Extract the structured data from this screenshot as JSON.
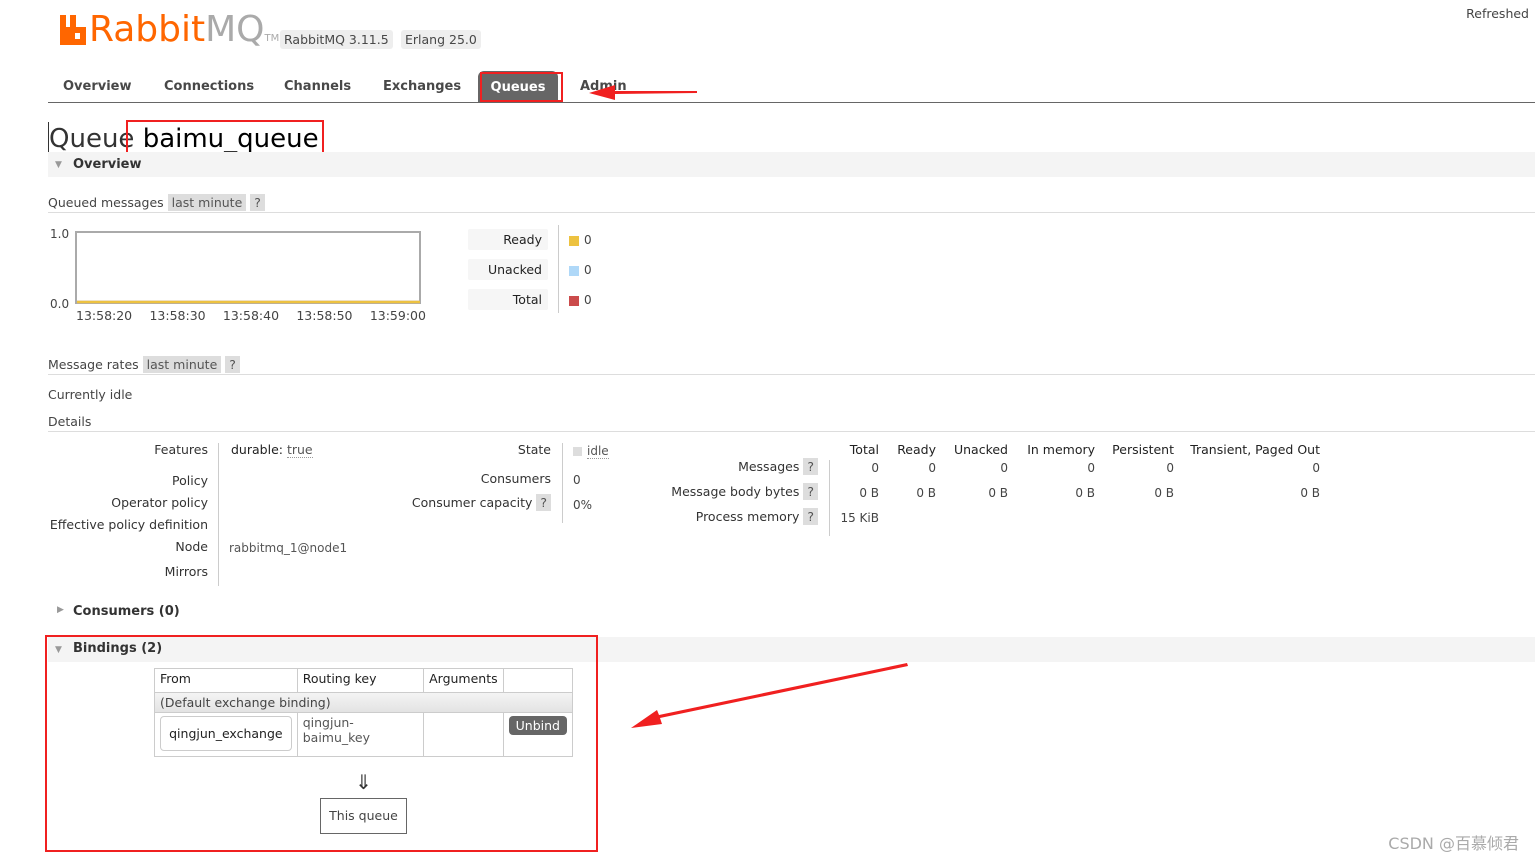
{
  "header": {
    "logo_main": "Rabbit",
    "logo_mq": "MQ",
    "logo_tm": "TM",
    "version": "RabbitMQ 3.11.5",
    "erlang": "Erlang 25.0",
    "refreshed": "Refreshed"
  },
  "nav": {
    "items": [
      "Overview",
      "Connections",
      "Channels",
      "Exchanges",
      "Queues",
      "Admin"
    ],
    "active": "Queues"
  },
  "page": {
    "title_prefix": "Queue",
    "queue_name": "baimu_queue"
  },
  "overview": {
    "title": "Overview",
    "queued_label": "Queued messages",
    "range": "last minute",
    "help": "?",
    "chart_data": {
      "type": "line",
      "x": [
        "13:58:20",
        "13:58:30",
        "13:58:40",
        "13:58:50",
        "13:59:00"
      ],
      "y_ticks": [
        "1.0",
        "0.0"
      ],
      "ylim": [
        0,
        1
      ],
      "series": [
        {
          "name": "Ready",
          "values": [
            0,
            0,
            0,
            0,
            0
          ],
          "color": "#edc240"
        },
        {
          "name": "Unacked",
          "values": [
            0,
            0,
            0,
            0,
            0
          ],
          "color": "#afd8f8"
        },
        {
          "name": "Total",
          "values": [
            0,
            0,
            0,
            0,
            0
          ],
          "color": "#cb4b4b"
        }
      ]
    },
    "legend": [
      {
        "label": "Ready",
        "value": "0",
        "color": "#edc240"
      },
      {
        "label": "Unacked",
        "value": "0",
        "color": "#afd8f8"
      },
      {
        "label": "Total",
        "value": "0",
        "color": "#cb4b4b"
      }
    ],
    "rates_label": "Message rates",
    "rates_range": "last minute",
    "idle": "Currently idle",
    "details": "Details"
  },
  "details": {
    "features_label": "Features",
    "features_key": "durable:",
    "features_val": "true",
    "policy": "Policy",
    "operator_policy": "Operator policy",
    "effective_policy": "Effective policy definition",
    "node_label": "Node",
    "node_val": "rabbitmq_1@node1",
    "mirrors": "Mirrors",
    "state_label": "State",
    "state_val": "idle",
    "consumers_label": "Consumers",
    "consumers_val": "0",
    "capacity_label": "Consumer capacity",
    "capacity_val": "0%"
  },
  "stats": {
    "headers": [
      "Total",
      "Ready",
      "Unacked",
      "In memory",
      "Persistent",
      "Transient, Paged Out"
    ],
    "rows": [
      {
        "label": "Messages",
        "values": [
          "0",
          "0",
          "0",
          "0",
          "0",
          "0"
        ]
      },
      {
        "label": "Message body bytes",
        "values": [
          "0 B",
          "0 B",
          "0 B",
          "0 B",
          "0 B",
          "0 B"
        ]
      },
      {
        "label": "Process memory",
        "values": [
          "15 KiB"
        ]
      }
    ]
  },
  "consumers": {
    "title": "Consumers (0)"
  },
  "bindings": {
    "title": "Bindings (2)",
    "headers": [
      "From",
      "Routing key",
      "Arguments"
    ],
    "default_row": "(Default exchange binding)",
    "row": {
      "from": "qingjun_exchange",
      "routing_key": "qingjun-baimu_key",
      "action": "Unbind"
    },
    "arrow": "⇓",
    "this_queue": "This queue"
  },
  "watermark": "CSDN @百慕倾君"
}
